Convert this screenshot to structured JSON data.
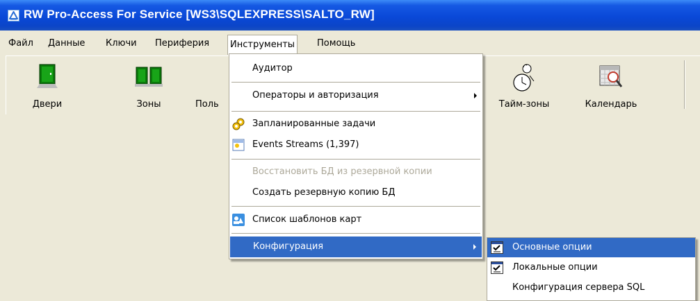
{
  "window": {
    "title": "RW Pro-Access For Service [WS3\\SQLEXPRESS\\SALTO_RW]",
    "app_icon": "app-logo-icon"
  },
  "menubar": {
    "items": [
      {
        "label": "Файл"
      },
      {
        "label": "Данные"
      },
      {
        "label": "Ключи"
      },
      {
        "label": "Периферия"
      },
      {
        "label": "Инструменты",
        "active": true
      },
      {
        "label": "Помощь"
      }
    ]
  },
  "toolbar": {
    "buttons": [
      {
        "label": "Двери",
        "icon": "door-icon"
      },
      {
        "label": "Зоны",
        "icon": "zones-icon"
      },
      {
        "label": "Поль",
        "icon": "users-icon"
      },
      {
        "label": "Тайм-зоны",
        "icon": "clock-person-icon"
      },
      {
        "label": "Календарь",
        "icon": "calendar-icon"
      }
    ]
  },
  "tools_menu": {
    "items": [
      {
        "label": "Аудитор"
      },
      {
        "label": "Операторы и авторизация",
        "submenu": true
      },
      {
        "label": "Запланированные задачи",
        "icon": "scheduled-tasks-icon"
      },
      {
        "label": "Events Streams (1,397)",
        "icon": "events-streams-icon"
      },
      {
        "label": "Восстановить БД из резервной копии",
        "disabled": true
      },
      {
        "label": "Создать резервную копию БД"
      },
      {
        "label": "Список шаблонов карт",
        "icon": "card-templates-icon"
      },
      {
        "label": "Конфигурация",
        "submenu": true,
        "highlighted": true
      }
    ]
  },
  "config_submenu": {
    "items": [
      {
        "label": "Основные опции",
        "icon": "checklist-icon",
        "highlighted": true
      },
      {
        "label": "Локальные опции",
        "icon": "checklist-icon"
      },
      {
        "label": "Конфигурация сервера SQL"
      }
    ]
  },
  "colors": {
    "title_bar": "#0a48d8",
    "highlight": "#316ac5",
    "menu_bg": "#ece9d8"
  }
}
